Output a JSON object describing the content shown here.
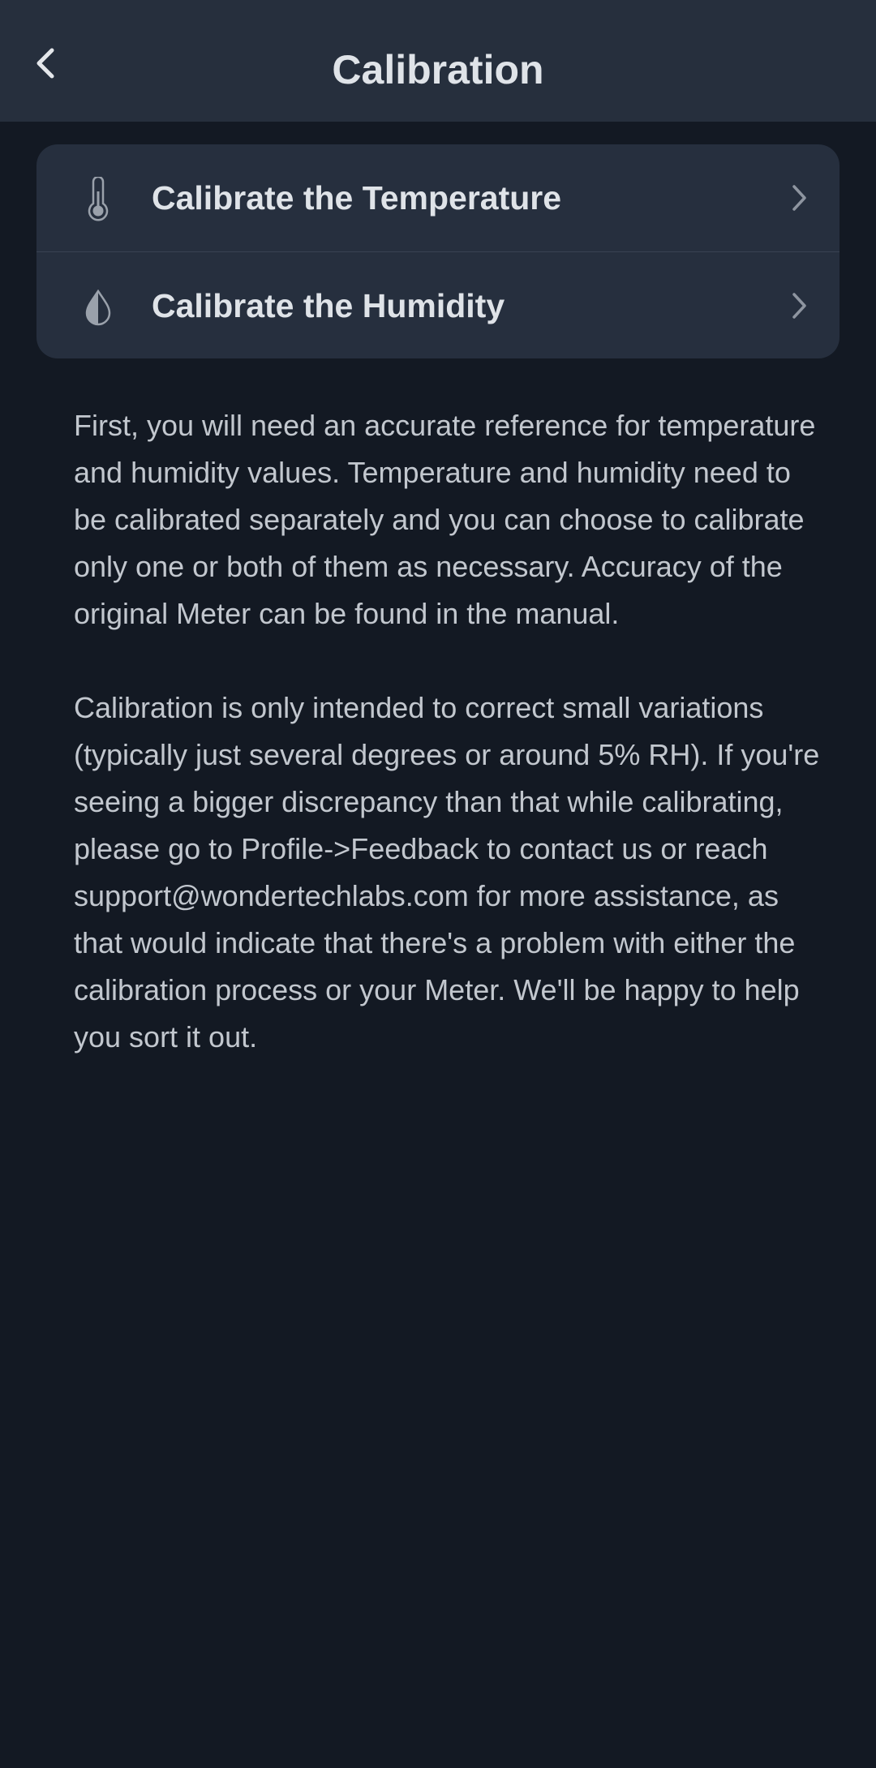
{
  "header": {
    "title": "Calibration",
    "back_icon": "chevron-left-icon"
  },
  "calibration_menu": {
    "items": [
      {
        "label": "Calibrate the Temperature",
        "icon": "thermometer-icon",
        "chevron": "chevron-right-icon"
      },
      {
        "label": "Calibrate the Humidity",
        "icon": "water-drop-icon",
        "chevron": "chevron-right-icon"
      }
    ]
  },
  "description": {
    "paragraph_1": "First, you will need an accurate reference for temperature and humidity values. Temperature and humidity need to be calibrated separately and you can choose to calibrate only one or both of them as necessary. Accuracy of the original Meter can be found in the manual.",
    "paragraph_2": "Calibration is only intended to correct small variations (typically just several degrees or around 5% RH). If you're seeing a bigger discrepancy than that while calibrating, please go to Profile->Feedback to contact us or reach support@wondertechlabs.com for more assistance, as that would indicate that there's a problem with either the calibration process or your Meter. We'll be happy to help you sort it out."
  },
  "colors": {
    "background": "#131923",
    "header_bg": "#262f3d",
    "card_bg": "#262f3e",
    "text_primary": "#dfe3e8",
    "text_secondary": "#c2c7ce"
  }
}
